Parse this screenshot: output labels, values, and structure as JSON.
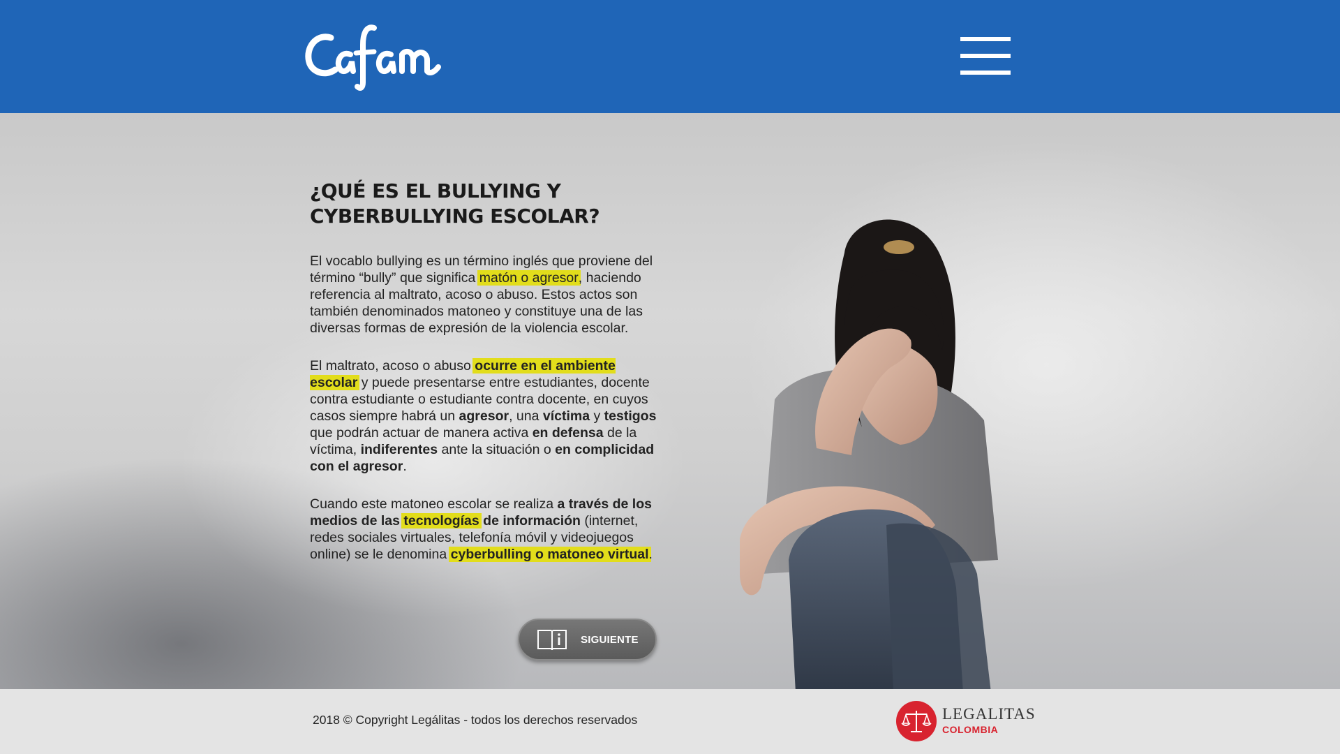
{
  "header": {
    "logo_text": "Cafam",
    "menu_icon": "hamburger-menu-icon",
    "background_color": "#1f65b7"
  },
  "main": {
    "title_line1": "¿QUÉ ES EL BULLYING Y",
    "title_line2": "CYBERBULLYING ESCOLAR?",
    "p1": {
      "t1": "El vocablo bullying es un término inglés que proviene del término “bully” que significa ",
      "hl1": "matón o agresor",
      "t2": ", haciendo referencia al maltrato, acoso o abuso. Estos actos son también denominados matoneo y constituye una de las diversas formas de expresión de la violencia escolar."
    },
    "p2": {
      "t1": "El maltrato, acoso o abuso ",
      "hl1": "ocurre en el ambiente escolar",
      "t2": " y puede presentarse entre estudiantes, docente contra estudiante o estudiante contra docente, en cuyos casos siempre habrá un ",
      "b1": "agresor",
      "t3": ", una ",
      "b2": "víctima",
      "t4": " y ",
      "b3": "testigos",
      "t5": " que podrán actuar de manera activa ",
      "b4": "en defensa",
      "t6": " de la víctima, ",
      "b5": "indiferentes",
      "t7": " ante la situación o ",
      "b6": "en complicidad con el agresor",
      "t8": "."
    },
    "p3": {
      "t1": "Cuando este matoneo escolar se realiza ",
      "b1": "a través de los medios de las ",
      "hl1": "tecnologías",
      "b2": " de información",
      "t2": " (internet, redes sociales virtuales, telefonía móvil y videojuegos online) se le denomina ",
      "hl2": "cyberbulling o matoneo virtual",
      "t3": "."
    },
    "highlight_color": "#e2dd1b",
    "next_button": {
      "label": "SIGUIENTE",
      "icon": "info-book-icon"
    }
  },
  "footer": {
    "copyright": "2018 © Copyright Legálitas - todos los derechos reservados",
    "partner_logo_brand": "LEGALITAS",
    "partner_logo_country": "COLOMBIA",
    "partner_logo_icon": "scales-of-justice-icon",
    "partner_color": "#d8232f"
  }
}
